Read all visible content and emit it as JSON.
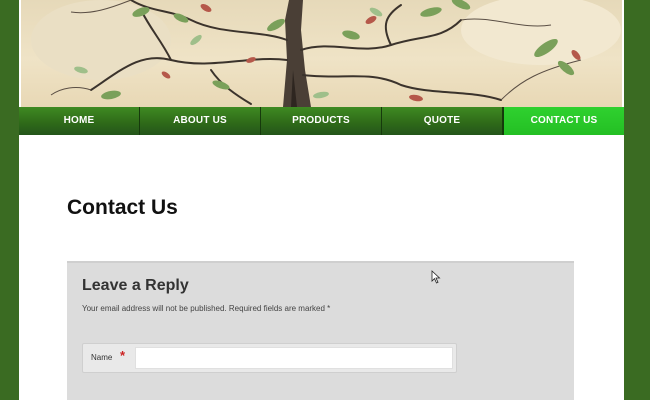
{
  "hero": {
    "image_icon": "bonsai-tree-image"
  },
  "nav": {
    "items": [
      {
        "label": "HOME"
      },
      {
        "label": "ABOUT US"
      },
      {
        "label": "PRODUCTS"
      },
      {
        "label": "QUOTE"
      },
      {
        "label": "CONTACT US"
      }
    ],
    "active_index": 4,
    "active_color": "#2fd12f",
    "bar_color": "#2f6b19"
  },
  "main": {
    "title": "Contact Us"
  },
  "reply": {
    "heading": "Leave a Reply",
    "note": "Your email address will not be published. Required fields are marked *",
    "name_label": "Name",
    "required_mark": "*",
    "name_value": ""
  },
  "colors": {
    "outer_background": "#3a6b22",
    "page_background": "#ffffff",
    "reply_background": "#dcdcdc"
  }
}
